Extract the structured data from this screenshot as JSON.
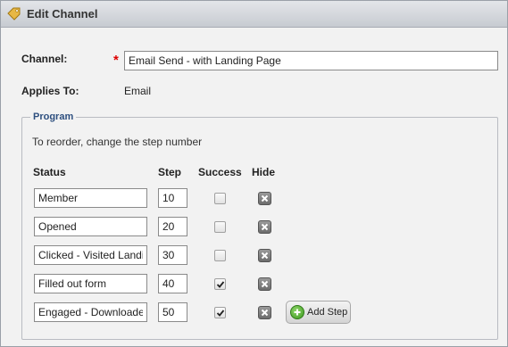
{
  "window": {
    "title": "Edit Channel",
    "title_icon": "tag-icon"
  },
  "form": {
    "channel_label": "Channel:",
    "required_marker": "*",
    "channel_value": "Email Send - with Landing Page",
    "applies_to_label": "Applies To:",
    "applies_to_value": "Email"
  },
  "program": {
    "legend": "Program",
    "hint": "To reorder, change the step number",
    "columns": {
      "status": "Status",
      "step": "Step",
      "success": "Success",
      "hide": "Hide"
    },
    "rows": [
      {
        "status": "Member",
        "step": "10",
        "success": false
      },
      {
        "status": "Opened",
        "step": "20",
        "success": false
      },
      {
        "status": "Clicked - Visited Landi",
        "step": "30",
        "success": false
      },
      {
        "status": "Filled out form",
        "step": "40",
        "success": true
      },
      {
        "status": "Engaged - Downloade",
        "step": "50",
        "success": true
      }
    ],
    "add_step_label": "Add Step"
  }
}
